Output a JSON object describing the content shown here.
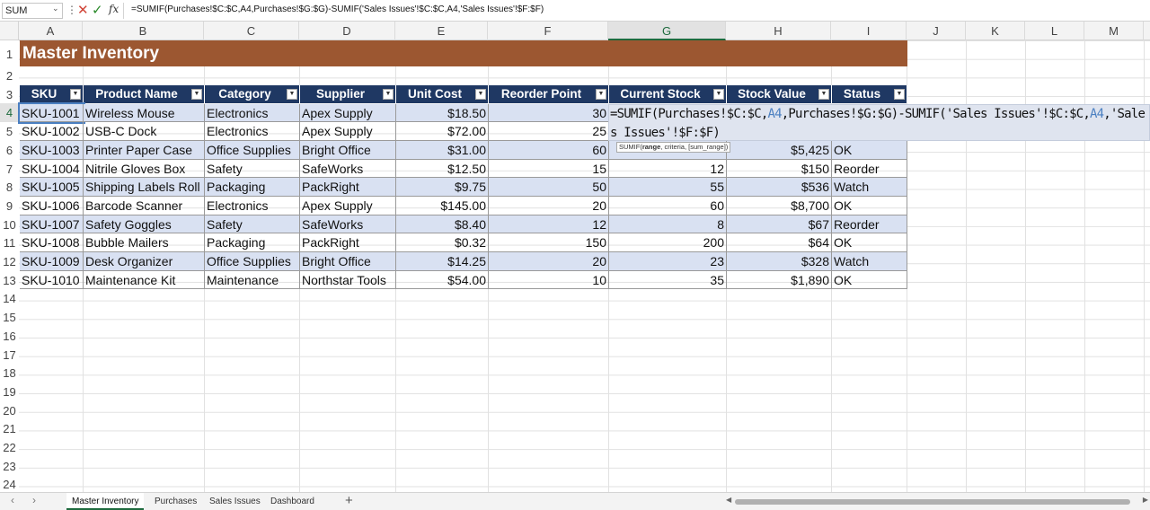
{
  "formula_bar": {
    "name_box": "SUM",
    "dots": "⋮",
    "cancel_icon": "✕",
    "enter_icon": "✓",
    "fx_label": "fx",
    "formula": "=SUMIF(Purchases!$C:$C,A4,Purchases!$G:$G)-SUMIF('Sales Issues'!$C:$C,A4,'Sales Issues'!$F:$F)"
  },
  "columns": [
    "A",
    "B",
    "C",
    "D",
    "E",
    "F",
    "G",
    "H",
    "I",
    "J",
    "K",
    "L",
    "M"
  ],
  "active_column": "G",
  "rows": [
    "1",
    "2",
    "3",
    "4",
    "5",
    "6",
    "7",
    "8",
    "9",
    "10",
    "11",
    "12",
    "13",
    "14",
    "15",
    "16",
    "17",
    "18",
    "19",
    "20",
    "21",
    "22",
    "23",
    "24"
  ],
  "active_row": "4",
  "title": "Master Inventory",
  "headers": [
    "SKU",
    "Product Name",
    "Category",
    "Supplier",
    "Unit Cost",
    "Reorder Point",
    "Current Stock",
    "Stock Value",
    "Status"
  ],
  "filter_icon": "▼",
  "data_rows": [
    {
      "sku": "SKU-1001",
      "name": "Wireless Mouse",
      "category": "Electronics",
      "supplier": "Apex Supply",
      "cost": "$18.50",
      "reorder": "30",
      "stock": "",
      "value": "",
      "status": ""
    },
    {
      "sku": "SKU-1002",
      "name": "USB-C Dock",
      "category": "Electronics",
      "supplier": "Apex Supply",
      "cost": "$72.00",
      "reorder": "25",
      "stock": "",
      "value": "",
      "status": ""
    },
    {
      "sku": "SKU-1003",
      "name": "Printer Paper Case",
      "category": "Office Supplies",
      "supplier": "Bright Office",
      "cost": "$31.00",
      "reorder": "60",
      "stock": "",
      "value": "$5,425",
      "status": "OK"
    },
    {
      "sku": "SKU-1004",
      "name": "Nitrile Gloves Box",
      "category": "Safety",
      "supplier": "SafeWorks",
      "cost": "$12.50",
      "reorder": "15",
      "stock": "12",
      "value": "$150",
      "status": "Reorder"
    },
    {
      "sku": "SKU-1005",
      "name": "Shipping Labels Roll",
      "category": "Packaging",
      "supplier": "PackRight",
      "cost": "$9.75",
      "reorder": "50",
      "stock": "55",
      "value": "$536",
      "status": "Watch"
    },
    {
      "sku": "SKU-1006",
      "name": "Barcode Scanner",
      "category": "Electronics",
      "supplier": "Apex Supply",
      "cost": "$145.00",
      "reorder": "20",
      "stock": "60",
      "value": "$8,700",
      "status": "OK"
    },
    {
      "sku": "SKU-1007",
      "name": "Safety Goggles",
      "category": "Safety",
      "supplier": "SafeWorks",
      "cost": "$8.40",
      "reorder": "12",
      "stock": "8",
      "value": "$67",
      "status": "Reorder"
    },
    {
      "sku": "SKU-1008",
      "name": "Bubble Mailers",
      "category": "Packaging",
      "supplier": "PackRight",
      "cost": "$0.32",
      "reorder": "150",
      "stock": "200",
      "value": "$64",
      "status": "OK"
    },
    {
      "sku": "SKU-1009",
      "name": "Desk Organizer",
      "category": "Office Supplies",
      "supplier": "Bright Office",
      "cost": "$14.25",
      "reorder": "20",
      "stock": "23",
      "value": "$328",
      "status": "Watch"
    },
    {
      "sku": "SKU-1010",
      "name": "Maintenance Kit",
      "category": "Maintenance",
      "supplier": "Northstar Tools",
      "cost": "$54.00",
      "reorder": "10",
      "stock": "35",
      "value": "$1,890",
      "status": "OK"
    }
  ],
  "editor": {
    "parts": [
      "=SUMIF(Purchases!$C:$C,",
      "A4",
      ",Purchases!$G:$G)-SUMIF('Sales Issues'!$C:$C,",
      "A4",
      ",'Sales Issues'!$F:$F)"
    ]
  },
  "tooltip": {
    "fn": "SUMIF(",
    "arg1": "range",
    "rest": ", criteria, [sum_range])"
  },
  "sheet_tabs": [
    "Master Inventory",
    "Purchases",
    "Sales Issues",
    "Dashboard"
  ],
  "active_tab": "Master Inventory",
  "add_sheet": "+",
  "nav_prev": "‹",
  "nav_next": "›"
}
